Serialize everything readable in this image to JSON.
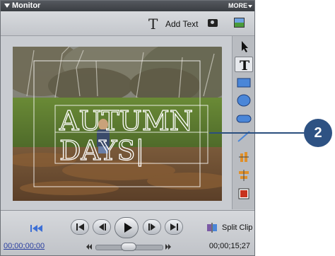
{
  "panel": {
    "title": "Monitor",
    "more_label": "MORE"
  },
  "toolbar": {
    "add_text_icon_glyph": "T",
    "add_text_label": "Add Text"
  },
  "preview": {
    "title_text_lines": [
      "AUTUMN",
      "DAYS|"
    ]
  },
  "tools": [
    {
      "name": "selection-tool",
      "icon": "arrow-icon",
      "active": false
    },
    {
      "name": "type-tool",
      "icon": "type-icon",
      "active": true
    },
    {
      "name": "rectangle-tool",
      "icon": "rectangle-icon",
      "active": false
    },
    {
      "name": "ellipse-tool",
      "icon": "ellipse-icon",
      "active": false
    },
    {
      "name": "rounded-rectangle-tool",
      "icon": "rounded-rect-icon",
      "active": false
    },
    {
      "name": "line-tool",
      "icon": "line-icon",
      "active": false
    },
    {
      "name": "vertical-align-tool",
      "icon": "vertical-align-icon",
      "active": false
    },
    {
      "name": "horizontal-align-tool",
      "icon": "horizontal-align-icon",
      "active": false
    },
    {
      "name": "color-tool",
      "icon": "color-swatch-icon",
      "active": false
    }
  ],
  "transport": {
    "current_timecode": "00;00;00;00",
    "duration_timecode": "00;00;15;27",
    "split_clip_label": "Split Clip"
  },
  "callout": {
    "number": "2"
  },
  "colors": {
    "title_text": "#ffffff",
    "callout_bg": "#2e5283",
    "accent_blue": "#3c6fd6"
  }
}
